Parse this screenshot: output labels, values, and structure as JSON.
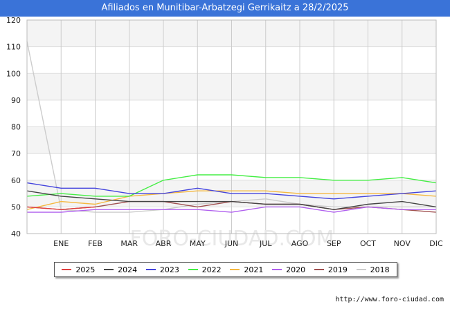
{
  "header": {
    "title": "Afiliados en Munitibar-Arbatzegi Gerrikaitz a 28/2/2025"
  },
  "footer": {
    "url": "http://www.foro-ciudad.com"
  },
  "watermark": "FORO-CIUDAD.COM",
  "chart_data": {
    "type": "line",
    "title": "Afiliados en Munitibar-Arbatzegi Gerrikaitz a 28/2/2025",
    "categories": [
      "",
      "ENE",
      "FEB",
      "MAR",
      "ABR",
      "MAY",
      "JUN",
      "JUL",
      "AGO",
      "SEP",
      "OCT",
      "NOV",
      "DIC"
    ],
    "ylim": [
      40,
      120
    ],
    "yticks": [
      40,
      50,
      60,
      70,
      80,
      90,
      100,
      110,
      120
    ],
    "grid": true,
    "legend_position": "bottom",
    "series": [
      {
        "name": "2025",
        "color": "#e04040",
        "values": [
          50,
          49,
          50
        ]
      },
      {
        "name": "2024",
        "color": "#444444",
        "values": [
          56,
          54,
          53,
          52,
          52,
          52,
          52,
          51,
          51,
          49,
          51,
          52,
          50
        ]
      },
      {
        "name": "2023",
        "color": "#4444dd",
        "values": [
          59,
          57,
          57,
          55,
          55,
          57,
          55,
          55,
          54,
          53,
          54,
          55,
          56
        ]
      },
      {
        "name": "2022",
        "color": "#44ee44",
        "values": [
          54,
          55,
          54,
          54,
          60,
          62,
          62,
          61,
          61,
          60,
          60,
          61,
          59
        ]
      },
      {
        "name": "2021",
        "color": "#f5b840",
        "values": [
          49,
          52,
          51,
          54,
          55,
          56,
          56,
          56,
          55,
          55,
          55,
          55,
          54
        ]
      },
      {
        "name": "2020",
        "color": "#b060ee",
        "values": [
          48,
          48,
          49,
          49,
          49,
          49,
          48,
          50,
          50,
          48,
          50,
          49,
          49
        ]
      },
      {
        "name": "2019",
        "color": "#a05050",
        "values": [
          50,
          49,
          50,
          52,
          52,
          50,
          52,
          51,
          51,
          49,
          50,
          49,
          48
        ]
      },
      {
        "name": "2018",
        "color": "#cccccc",
        "values": [
          112,
          49,
          48,
          48,
          49,
          51,
          52,
          53,
          51,
          50,
          50,
          50,
          50
        ]
      }
    ]
  }
}
